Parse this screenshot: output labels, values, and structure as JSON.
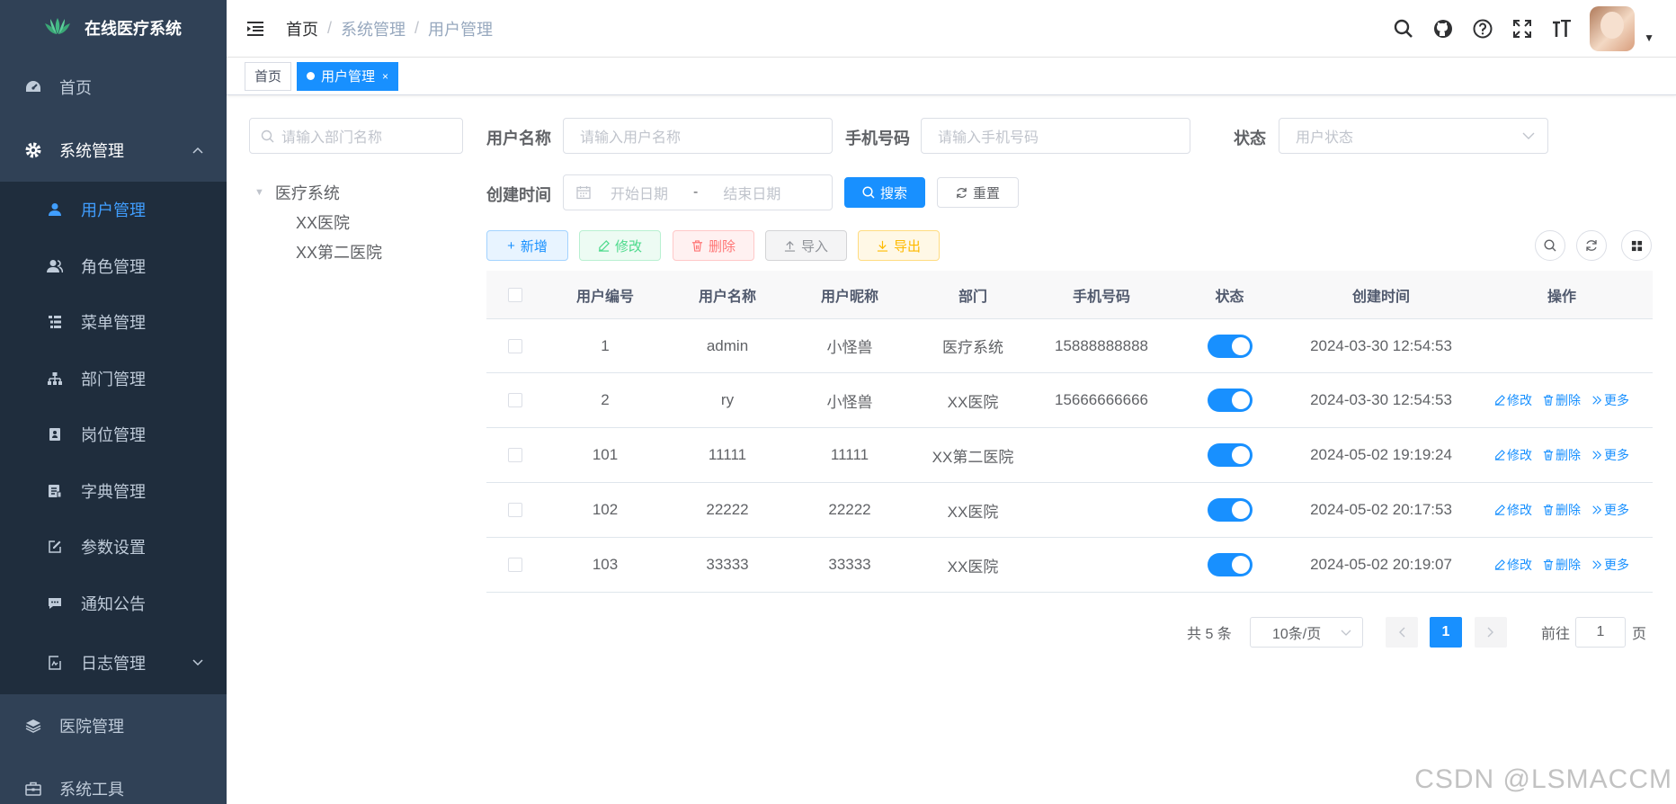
{
  "app": {
    "title": "在线医疗系统"
  },
  "sidebar": {
    "home": "首页",
    "system": "系统管理",
    "sub_items": [
      "用户管理",
      "角色管理",
      "菜单管理",
      "部门管理",
      "岗位管理",
      "字典管理",
      "参数设置",
      "通知公告",
      "日志管理"
    ],
    "hospital": "医院管理",
    "tools": "系统工具"
  },
  "breadcrumb": [
    "首页",
    "系统管理",
    "用户管理"
  ],
  "tags": [
    "首页",
    "用户管理"
  ],
  "dept": {
    "search_placeholder": "请输入部门名称",
    "root": "医疗系统",
    "children": [
      "XX医院",
      "XX第二医院"
    ]
  },
  "form": {
    "username_label": "用户名称",
    "username_placeholder": "请输入用户名称",
    "phone_label": "手机号码",
    "phone_placeholder": "请输入手机号码",
    "status_label": "状态",
    "status_placeholder": "用户状态",
    "created_label": "创建时间",
    "start_placeholder": "开始日期",
    "range_sep": "-",
    "end_placeholder": "结束日期",
    "search_btn": "搜索",
    "reset_btn": "重置"
  },
  "toolbar": {
    "add": "新增",
    "edit": "修改",
    "delete": "删除",
    "import": "导入",
    "export": "导出"
  },
  "table": {
    "headers": [
      "用户编号",
      "用户名称",
      "用户昵称",
      "部门",
      "手机号码",
      "状态",
      "创建时间",
      "操作"
    ],
    "rows": [
      {
        "id": "1",
        "name": "admin",
        "nick": "小怪兽",
        "dept": "医疗系统",
        "phone": "15888888888",
        "status": true,
        "created": "2024-03-30 12:54:53",
        "ops": false
      },
      {
        "id": "2",
        "name": "ry",
        "nick": "小怪兽",
        "dept": "XX医院",
        "phone": "15666666666",
        "status": true,
        "created": "2024-03-30 12:54:53",
        "ops": true
      },
      {
        "id": "101",
        "name": "11111",
        "nick": "11111",
        "dept": "XX第二医院",
        "phone": "",
        "status": true,
        "created": "2024-05-02 19:19:24",
        "ops": true
      },
      {
        "id": "102",
        "name": "22222",
        "nick": "22222",
        "dept": "XX医院",
        "phone": "",
        "status": true,
        "created": "2024-05-02 20:17:53",
        "ops": true
      },
      {
        "id": "103",
        "name": "33333",
        "nick": "33333",
        "dept": "XX医院",
        "phone": "",
        "status": true,
        "created": "2024-05-02 20:19:07",
        "ops": true
      }
    ],
    "op_edit": "修改",
    "op_delete": "删除",
    "op_more": "更多"
  },
  "pagination": {
    "total": "共 5 条",
    "page_size": "10条/页",
    "current": "1",
    "goto_label": "前往",
    "goto_value": "1",
    "page_unit": "页"
  },
  "watermark": "CSDN @LSMACCM",
  "colors": {
    "sidebar_bg": "#304156",
    "submenu_bg": "#1f2d3d",
    "primary": "#1890ff"
  }
}
